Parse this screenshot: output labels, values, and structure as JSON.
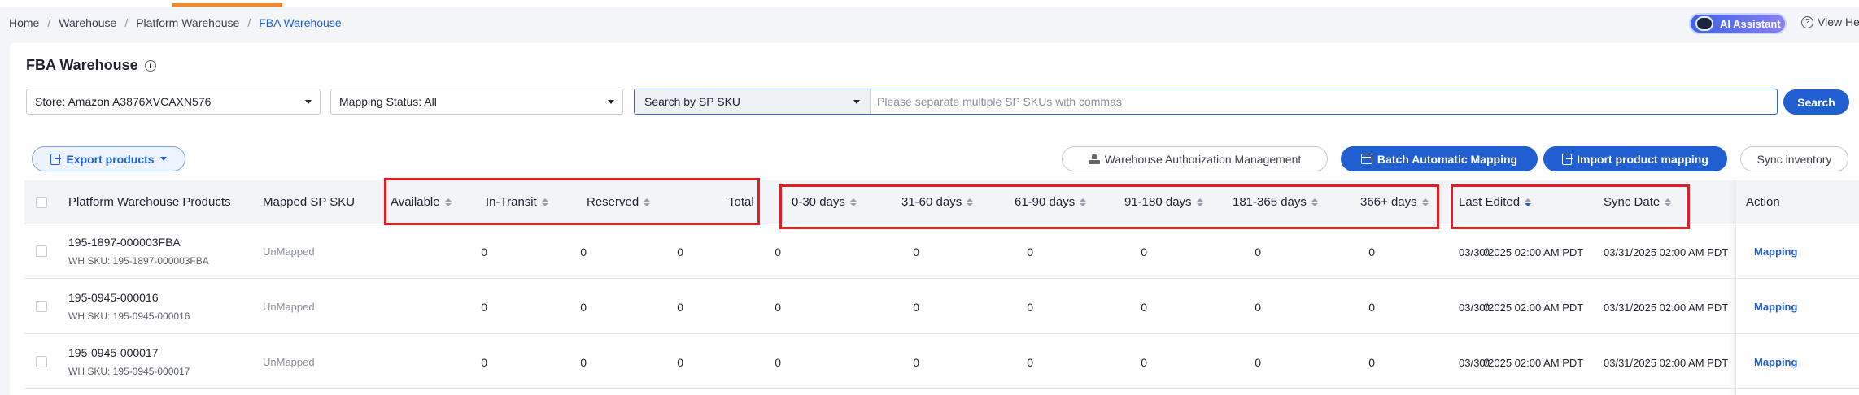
{
  "breadcrumb": [
    "Home",
    "Warehouse",
    "Platform Warehouse",
    "FBA Warehouse"
  ],
  "header": {
    "ai_label": "AI Assistant",
    "help_label": "View He"
  },
  "page": {
    "title": "FBA Warehouse"
  },
  "filters": {
    "store": "Store: Amazon A3876XVCAXN576",
    "mapping_status": "Mapping Status: All",
    "search_type": "Search by SP SKU",
    "search_placeholder": "Please separate multiple SP SKUs with commas",
    "search_button": "Search"
  },
  "toolbar": {
    "export": "Export products",
    "auth_mgmt": "Warehouse Authorization Management",
    "batch_mapping": "Batch Automatic Mapping",
    "import_mapping": "Import product mapping",
    "sync_inventory": "Sync inventory"
  },
  "table": {
    "columns": {
      "product": "Platform Warehouse Products",
      "mapped": "Mapped SP SKU",
      "available": "Available",
      "in_transit": "In-Transit",
      "reserved": "Reserved",
      "total": "Total",
      "d0_30": "0-30 days",
      "d31_60": "31-60 days",
      "d61_90": "61-90 days",
      "d91_180": "91-180 days",
      "d181_365": "181-365 days",
      "d366": "366+ days",
      "last_edited": "Last Edited",
      "sync_date": "Sync Date",
      "action": "Action"
    },
    "rows": [
      {
        "sku": "195-1897-000003FBA",
        "wh_sku": "WH SKU: 195-1897-000003FBA",
        "mapped": "UnMapped",
        "available": "0",
        "in_transit": "0",
        "reserved": "0",
        "total": "0",
        "d0_30": "0",
        "d31_60": "0",
        "d61_90": "0",
        "d91_180": "0",
        "d181_365": "0",
        "d366": "0",
        "last_edited": "03/30/2025 02:00 AM PDT",
        "sync_date": "03/31/2025 02:00 AM PDT",
        "action": "Mapping"
      },
      {
        "sku": "195-0945-000016",
        "wh_sku": "WH SKU: 195-0945-000016",
        "mapped": "UnMapped",
        "available": "0",
        "in_transit": "0",
        "reserved": "0",
        "total": "0",
        "d0_30": "0",
        "d31_60": "0",
        "d61_90": "0",
        "d91_180": "0",
        "d181_365": "0",
        "d366": "0",
        "last_edited": "03/30/2025 02:00 AM PDT",
        "sync_date": "03/31/2025 02:00 AM PDT",
        "action": "Mapping"
      },
      {
        "sku": "195-0945-000017",
        "wh_sku": "WH SKU: 195-0945-000017",
        "mapped": "UnMapped",
        "available": "0",
        "in_transit": "0",
        "reserved": "0",
        "total": "0",
        "d0_30": "0",
        "d31_60": "0",
        "d61_90": "0",
        "d91_180": "0",
        "d181_365": "0",
        "d366": "0",
        "last_edited": "03/30/2025 02:00 AM PDT",
        "sync_date": "03/31/2025 02:00 AM PDT",
        "action": "Mapping"
      }
    ]
  },
  "colors": {
    "primary": "#1f5fd1",
    "highlight": "#e41b23",
    "accent": "#f08a24"
  }
}
